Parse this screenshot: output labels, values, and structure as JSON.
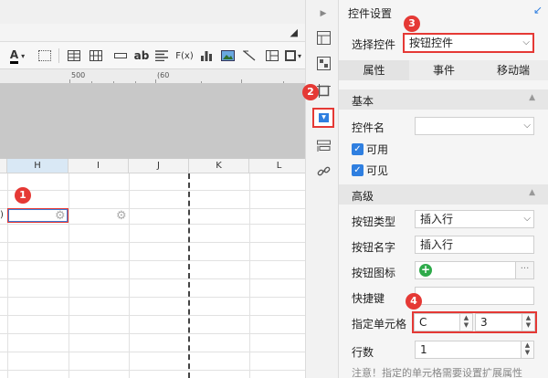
{
  "toolbar": {
    "font_color_glyph": "A",
    "text_ab": "ab",
    "formula_label": "F(x)"
  },
  "ruler": {
    "mark_500": "500",
    "mark_60": "(60"
  },
  "sheet": {
    "columns": [
      "H",
      "I",
      "J",
      "K",
      "L"
    ],
    "selected_column": "H",
    "left_edge_glyph": ")"
  },
  "badges": [
    "1",
    "2",
    "3",
    "4"
  ],
  "panel": {
    "title": "控件设置",
    "select_control_label": "选择控件",
    "select_control_value": "按钮控件",
    "tabs": [
      "属性",
      "事件",
      "移动端"
    ],
    "basic_section": "基本",
    "control_name_label": "控件名",
    "control_name_value": "",
    "checkbox_enabled": "可用",
    "checkbox_visible": "可见",
    "advanced_section": "高级",
    "button_type_label": "按钮类型",
    "button_type_value": "插入行",
    "button_name_label": "按钮名字",
    "button_name_value": "插入行",
    "button_icon_label": "按钮图标",
    "shortcut_label": "快捷键",
    "shortcut_value": "",
    "cell_label": "指定单元格",
    "cell_col_value": "C",
    "cell_row_value": "3",
    "row_count_label": "行数",
    "row_count_value": "1",
    "note": "注意！指定的单元格需要设置扩展属性"
  },
  "colors": {
    "accent_blue": "#2f7fe0",
    "highlight_red": "#e53935",
    "add_green": "#2eaa4a"
  }
}
